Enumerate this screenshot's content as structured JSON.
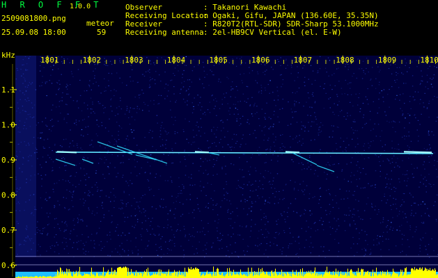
{
  "header": {
    "app_title": "H R O F F T",
    "version": "1.0.0",
    "filename": "2509081800.png",
    "datetime": "25.09.08 18:00",
    "meteor_label": "meteor",
    "meteor_count": "59",
    "info": [
      {
        "label": "Observer",
        "value": ": Takanori Kawachi"
      },
      {
        "label": "Receiving Location",
        "value": ": Ogaki, Gifu, JAPAN (136.60E, 35.35N)"
      },
      {
        "label": "Receiver",
        "value": ": R820T2(RTL-SDR) SDR-Sharp 53.1000MHz"
      },
      {
        "label": "Receiving antenna",
        "value": ": 2el-HB9CV Vertical (el. E-W)"
      }
    ]
  },
  "chart_data": {
    "type": "heatmap",
    "ylabel": "kHz",
    "x_ticks": [
      "1801",
      "1802",
      "1803",
      "1804",
      "1805",
      "1806",
      "1807",
      "1808",
      "1809",
      "1810"
    ],
    "y_ticks": [
      "1.1",
      "1.0",
      "0.9",
      "0.8",
      "0.7",
      "0.6"
    ],
    "xlim": [
      1800.5,
      1810.5
    ],
    "ylim": [
      0.55,
      1.2
    ],
    "carrier_khz": 0.92,
    "colors": {
      "background": "#00003a",
      "noise": "#1a2a9a",
      "signal": "#30e0ff",
      "strong": "#ffffff",
      "bar": "#ffff00",
      "axis": "#ffff00"
    }
  }
}
